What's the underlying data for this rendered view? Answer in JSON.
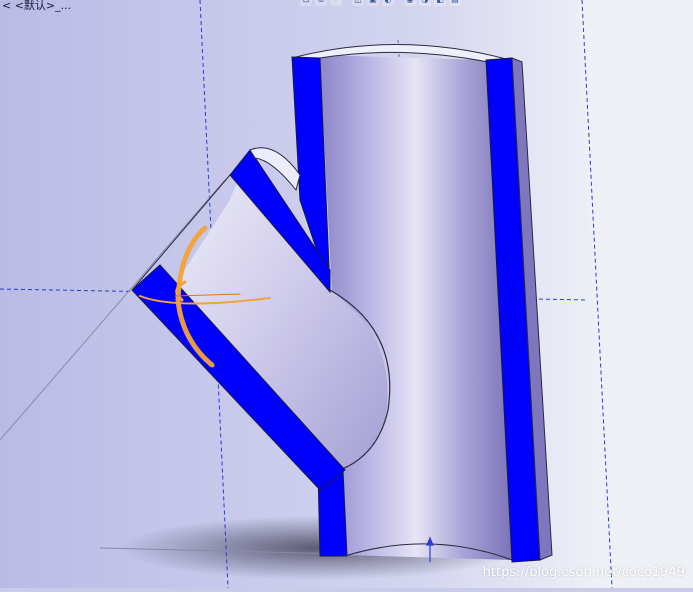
{
  "viewport": {
    "breadcrumb": "< <默认>_...",
    "watermark": "https://blog.csdn.net/coco1949"
  },
  "hud_toolbar": {
    "items": [
      {
        "name": "zoom-to-fit-icon",
        "glyph": "⊡"
      },
      {
        "name": "zoom-area-icon",
        "glyph": "⊕"
      },
      {
        "name": "previous-view-icon",
        "glyph": "↶"
      },
      {
        "name": "section-view-icon",
        "glyph": "◫"
      },
      {
        "name": "view-orientation-icon",
        "glyph": "▣"
      },
      {
        "name": "display-style-icon",
        "glyph": "◐"
      },
      {
        "name": "hide-show-items-icon",
        "glyph": "◉"
      },
      {
        "name": "edit-appearance-icon",
        "glyph": "◑"
      },
      {
        "name": "apply-scene-icon",
        "glyph": "◧"
      },
      {
        "name": "view-settings-icon",
        "glyph": "▤"
      }
    ]
  },
  "colors": {
    "background": "#c9cbe9",
    "section_face": "#0000ff",
    "pipe_surface": "#b7b4e0",
    "triad": "#f2a33a",
    "sketch_lines": "#2b3bd6"
  }
}
